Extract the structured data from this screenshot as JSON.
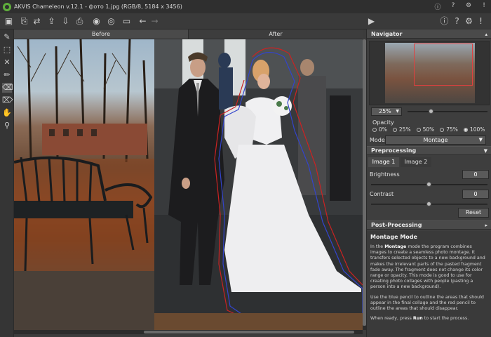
{
  "window": {
    "title": "AKVIS Chameleon v.12.1 - фото 1.jpg (RGB/8, 5184 x 3456)",
    "controls": [
      "info-icon",
      "help-icon",
      "settings-icon",
      "notifications-icon"
    ]
  },
  "toolbar": {
    "buttons": [
      "open-icon",
      "save-icon",
      "swap-icon",
      "load-object-icon",
      "load-bg-icon",
      "print-icon",
      "batch-icon",
      "presets-icon",
      "ruler-icon",
      "undo-icon",
      "redo-icon",
      "run-icon"
    ]
  },
  "view_tabs": {
    "before": "Before",
    "after": "After"
  },
  "tools": [
    "pencil-blue-icon",
    "selection-icon",
    "transform-icon",
    "pencil-red-icon",
    "eraser-icon",
    "smart-eraser-icon",
    "hand-icon",
    "zoom-icon"
  ],
  "navigator": {
    "title": "Navigator",
    "zoom": "25%"
  },
  "opacity": {
    "label": "Opacity",
    "options": [
      "0%",
      "25%",
      "50%",
      "75%",
      "100%"
    ],
    "selected": "100%"
  },
  "mode": {
    "label": "Mode",
    "value": "Montage"
  },
  "preprocessing": {
    "title": "Preprocessing",
    "tabs": [
      "Image 1",
      "Image 2"
    ],
    "active_tab": "Image 1",
    "brightness_label": "Brightness",
    "brightness_value": "0",
    "contrast_label": "Contrast",
    "contrast_value": "0",
    "reset_label": "Reset"
  },
  "postprocessing": {
    "title": "Post-Processing"
  },
  "help": {
    "title": "Montage Mode",
    "p1_pre": "In the ",
    "p1_bold": "Montage",
    "p1_post": " mode the program combines images to create a seamless photo montage. It transfers selected objects to a new background and makes the irrelevant parts of the pasted fragment fade away. The fragment does not change its color range or opacity. This mode is good to use for creating photo collages with people (pasting a person into a new background).",
    "p2": "Use the blue pencil to outline the areas that should appear in the final collage and the red pencil to outline the areas that should disappear.",
    "p3_pre": "When ready, press ",
    "p3_bold": "Run",
    "p3_post": " to start the process."
  },
  "colors": {
    "accent": "#e04040",
    "outline_blue": "#3344cc",
    "outline_red": "#cc2222"
  }
}
